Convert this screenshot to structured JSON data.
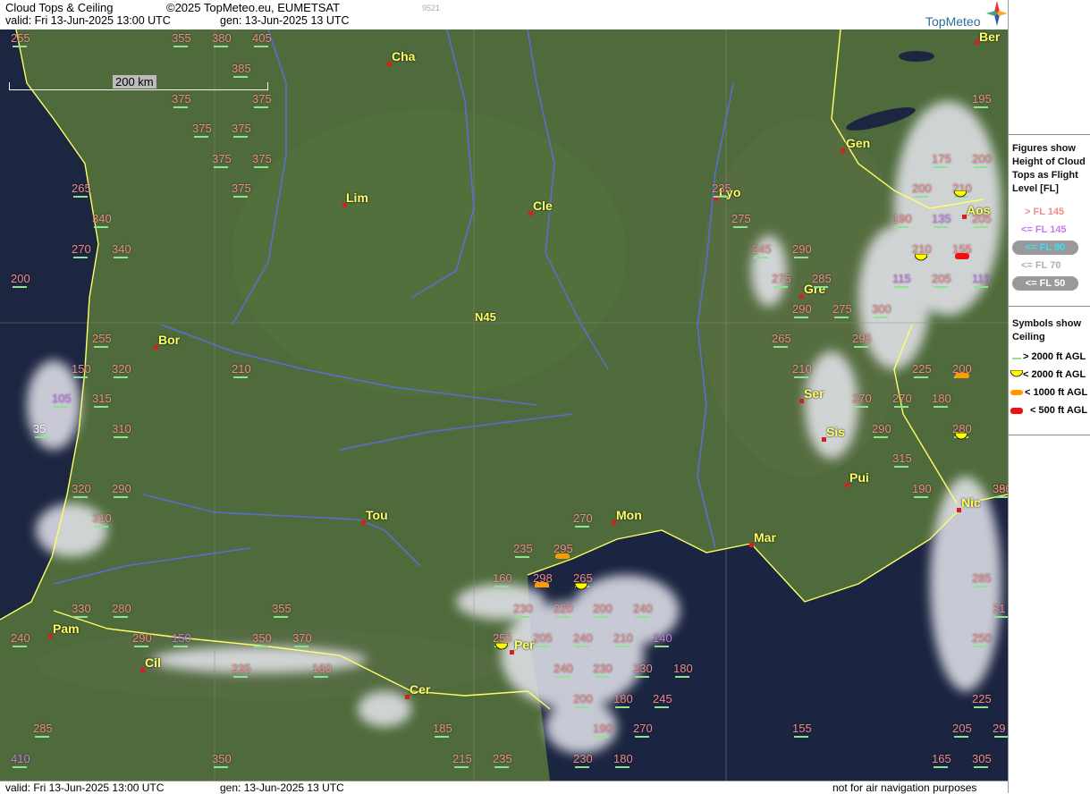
{
  "header": {
    "title": "Cloud Tops & Ceiling",
    "copyright": "©2025 TopMeteo.eu, EUMETSAT",
    "valid": "valid:  Fri  13-Jun-2025  13:00 UTC",
    "gen": "gen: 13-Jun-2025 13 UTC",
    "code": "9521",
    "logo_text": "TopMeteo"
  },
  "footer": {
    "valid": "valid:  Fri  13-Jun-2025  13:00 UTC",
    "gen": "gen: 13-Jun-2025 13 UTC",
    "disclaimer": "not for air navigation purposes"
  },
  "map": {
    "scale_label": "200 km",
    "grid_label": "N45",
    "colors": {
      "land": "#4e6a3a",
      "sea": "#1d2640",
      "coast": "#ffff66",
      "river": "#5a6fe0",
      "cloud": "#e8e8ee"
    }
  },
  "cities": [
    {
      "name": "Cha"
    },
    {
      "name": "Ber"
    },
    {
      "name": "Gen"
    },
    {
      "name": "Lim"
    },
    {
      "name": "Cle"
    },
    {
      "name": "Lyo"
    },
    {
      "name": "Aos"
    },
    {
      "name": "Gre"
    },
    {
      "name": "Bor"
    },
    {
      "name": "Ser"
    },
    {
      "name": "Sis"
    },
    {
      "name": "Pui"
    },
    {
      "name": "Nic"
    },
    {
      "name": "Tou"
    },
    {
      "name": "Mon"
    },
    {
      "name": "Mar"
    },
    {
      "name": "Pam"
    },
    {
      "name": "Cil"
    },
    {
      "name": "Per"
    },
    {
      "name": "Cer"
    }
  ],
  "flight_levels": [
    "255",
    "355",
    "380",
    "405",
    "385",
    "375",
    "375",
    "375",
    "375",
    "375",
    "375",
    "375",
    "265",
    "340",
    "270",
    "340",
    "200",
    "255",
    "150",
    "320",
    "105",
    "315",
    "35",
    "310",
    "210",
    "235",
    "275",
    "245",
    "290",
    "275",
    "285",
    "290",
    "275",
    "300",
    "265",
    "295",
    "210",
    "270",
    "270",
    "290",
    "315",
    "190",
    "175",
    "200",
    "200",
    "210",
    "190",
    "135",
    "205",
    "210",
    "155",
    "115",
    "115",
    "205",
    "225",
    "200",
    "180",
    "280",
    "195",
    "390",
    "290",
    "320",
    "310",
    "160",
    "298",
    "265",
    "270",
    "235",
    "295",
    "330",
    "280",
    "355",
    "290",
    "150",
    "350",
    "370",
    "240",
    "160",
    "235",
    "230",
    "220",
    "200",
    "240",
    "255",
    "205",
    "240",
    "210",
    "140",
    "240",
    "230",
    "230",
    "180",
    "200",
    "180",
    "245",
    "185",
    "190",
    "270",
    "285",
    "215",
    "235",
    "230",
    "180",
    "155",
    "410",
    "350",
    "285",
    "250",
    "225",
    "205",
    "165",
    "305",
    "31",
    "38",
    "29"
  ],
  "legend": {
    "figures_title": [
      "Figures show",
      "Height of Cloud",
      "Tops as Flight",
      "Level  [FL]"
    ],
    "fl_items": [
      {
        "label": "> FL 145",
        "color": "#f08a8a"
      },
      {
        "label": "<= FL 145",
        "color": "#c67be8"
      },
      {
        "label": "<= FL 90",
        "color": "#38e0ff"
      },
      {
        "label": "<= FL 70",
        "color": "#b0b0b0"
      },
      {
        "label": "<= FL 50",
        "color": "#ffffff"
      }
    ],
    "symbols_title": [
      "Symbols show",
      "Ceiling"
    ],
    "symbol_items": [
      {
        "label": "> 2000 ft AGL",
        "icon": "green-line-icon",
        "color": "#8fe28f"
      },
      {
        "label": "< 2000 ft AGL",
        "icon": "yellow-semicircle-icon",
        "color": "#ffff00"
      },
      {
        "label": "< 1000 ft AGL",
        "icon": "orange-bar-icon",
        "color": "#ff9900"
      },
      {
        "label": "< 500 ft AGL",
        "icon": "red-bar-icon",
        "color": "#ee1111"
      }
    ]
  }
}
